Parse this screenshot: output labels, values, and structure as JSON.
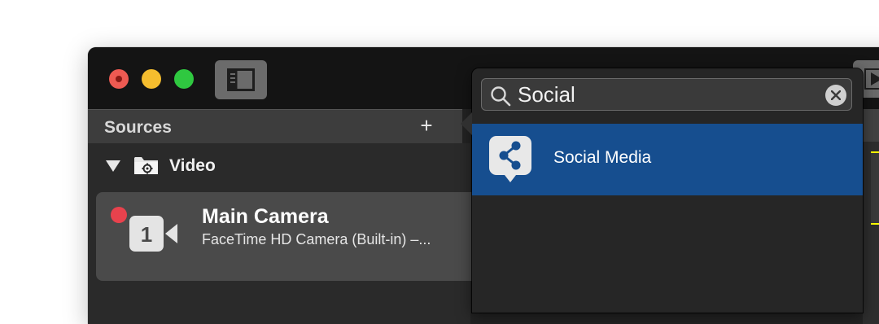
{
  "sources": {
    "title": "Sources",
    "add_label": "+",
    "group": {
      "label": "Video"
    },
    "camera": {
      "title": "Main Camera",
      "subtitle": "FaceTime HD Camera (Built-in) –...",
      "number": "1",
      "recording_color": "#e8424d"
    }
  },
  "search": {
    "value": "Social",
    "results": [
      {
        "label": "Social Media",
        "icon": "share-icon",
        "selected": true
      }
    ]
  },
  "colors": {
    "selection": "#164e8f",
    "accent_line": "#ffff00"
  }
}
